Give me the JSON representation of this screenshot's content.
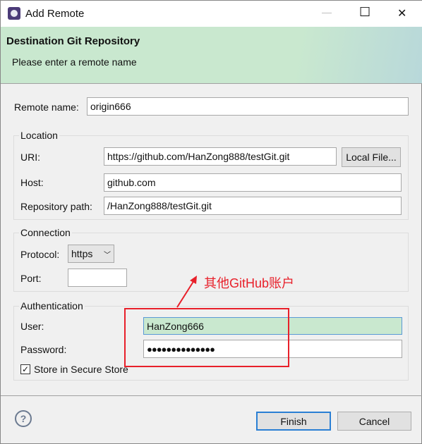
{
  "window": {
    "title": "Add Remote",
    "minimize": "—",
    "maximize": "☐",
    "close": "✕"
  },
  "header": {
    "title": "Destination Git Repository",
    "message": "Please enter a remote name"
  },
  "remote_name": {
    "label": "Remote name:",
    "value": "origin666"
  },
  "location": {
    "legend": "Location",
    "uri_label": "URI:",
    "uri_value": "https://github.com/HanZong888/testGit.git",
    "local_file_button": "Local File...",
    "host_label": "Host:",
    "host_value": "github.com",
    "path_label": "Repository path:",
    "path_value": "/HanZong888/testGit.git"
  },
  "connection": {
    "legend": "Connection",
    "protocol_label": "Protocol:",
    "protocol_value": "https",
    "port_label": "Port:",
    "port_value": ""
  },
  "authentication": {
    "legend": "Authentication",
    "user_label": "User:",
    "user_value": "HanZong666",
    "password_label": "Password:",
    "password_value": "●●●●●●●●●●●●●●",
    "store_label": "Store in Secure Store",
    "store_checked": true
  },
  "annotation": {
    "text": "其他GitHub账户",
    "color": "#e8202a"
  },
  "footer": {
    "help": "?",
    "finish": "Finish",
    "cancel": "Cancel"
  }
}
